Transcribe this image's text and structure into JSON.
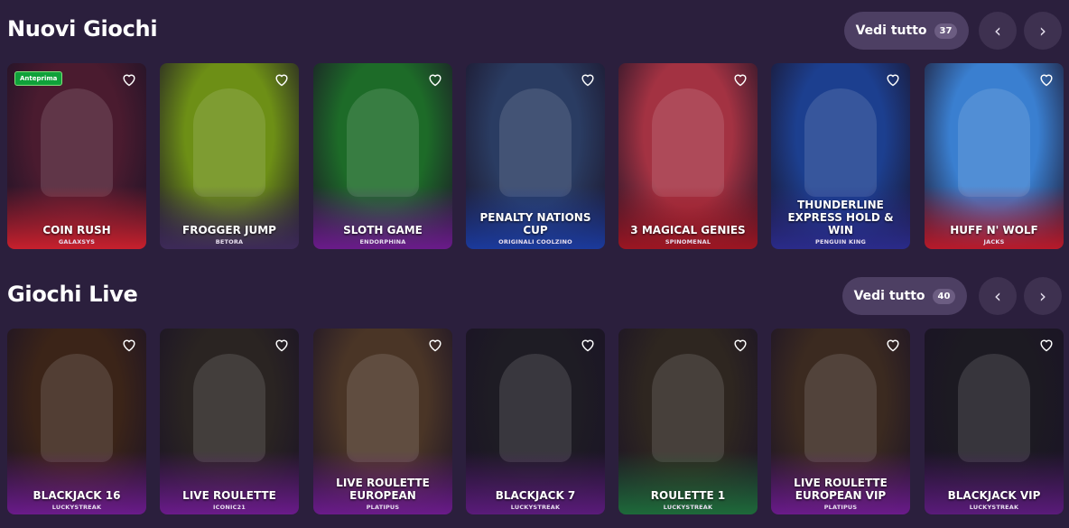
{
  "sections": [
    {
      "title": "Nuovi Giochi",
      "see_all_label": "Vedi tutto",
      "count": "37",
      "games": [
        {
          "name": "COIN RUSH",
          "provider": "GALAXSYS",
          "badge": "Anteprima",
          "bg": "#4a1b2f",
          "accent": "#c8202d"
        },
        {
          "name": "FROGGER JUMP",
          "provider": "BETORA",
          "bg": "#6d8f16",
          "accent": "#3d2a58"
        },
        {
          "name": "SLOTH GAME",
          "provider": "ENDORPHINA",
          "bg": "#1d6b28",
          "accent": "#6a1b8a"
        },
        {
          "name": "PENALTY NATIONS CUP",
          "provider": "ORIGINALI COOLZINO",
          "bg": "#2a3c62",
          "accent": "#1b3a9c"
        },
        {
          "name": "3 MAGICAL GENIES",
          "provider": "SPINOMENAL",
          "bg": "#a33242",
          "accent": "#9c1622"
        },
        {
          "name": "THUNDERLINE EXPRESS HOLD & WIN",
          "provider": "PENGUIN KING",
          "bg": "#1c3f8f",
          "accent": "#2a2b8a"
        },
        {
          "name": "HUFF N' WOLF",
          "provider": "JACKS",
          "bg": "#3a7fd0",
          "accent": "#b81a2a"
        }
      ]
    },
    {
      "title": "Giochi Live",
      "see_all_label": "Vedi tutto",
      "count": "40",
      "games": [
        {
          "name": "BLACKJACK 16",
          "provider": "LUCKYSTREAK",
          "bg": "#3b2418",
          "accent": "#6a1b8a"
        },
        {
          "name": "LIVE ROULETTE",
          "provider": "ICONIC21",
          "bg": "#2a2422",
          "accent": "#6a1b8a"
        },
        {
          "name": "LIVE ROULETTE EUROPEAN",
          "provider": "PLATIPUS",
          "bg": "#4a3526",
          "accent": "#6a1b8a"
        },
        {
          "name": "BLACKJACK 7",
          "provider": "LUCKYSTREAK",
          "bg": "#1e1c24",
          "accent": "#5a1b7a"
        },
        {
          "name": "ROULETTE 1",
          "provider": "LUCKYSTREAK",
          "bg": "#2e2620",
          "accent": "#1e6a3a"
        },
        {
          "name": "LIVE ROULETTE EUROPEAN VIP",
          "provider": "PLATIPUS",
          "bg": "#3b2a20",
          "accent": "#6a1b8a"
        },
        {
          "name": "BLACKJACK VIP",
          "provider": "LUCKYSTREAK",
          "bg": "#1c1a22",
          "accent": "#5a1b7a"
        }
      ]
    }
  ]
}
